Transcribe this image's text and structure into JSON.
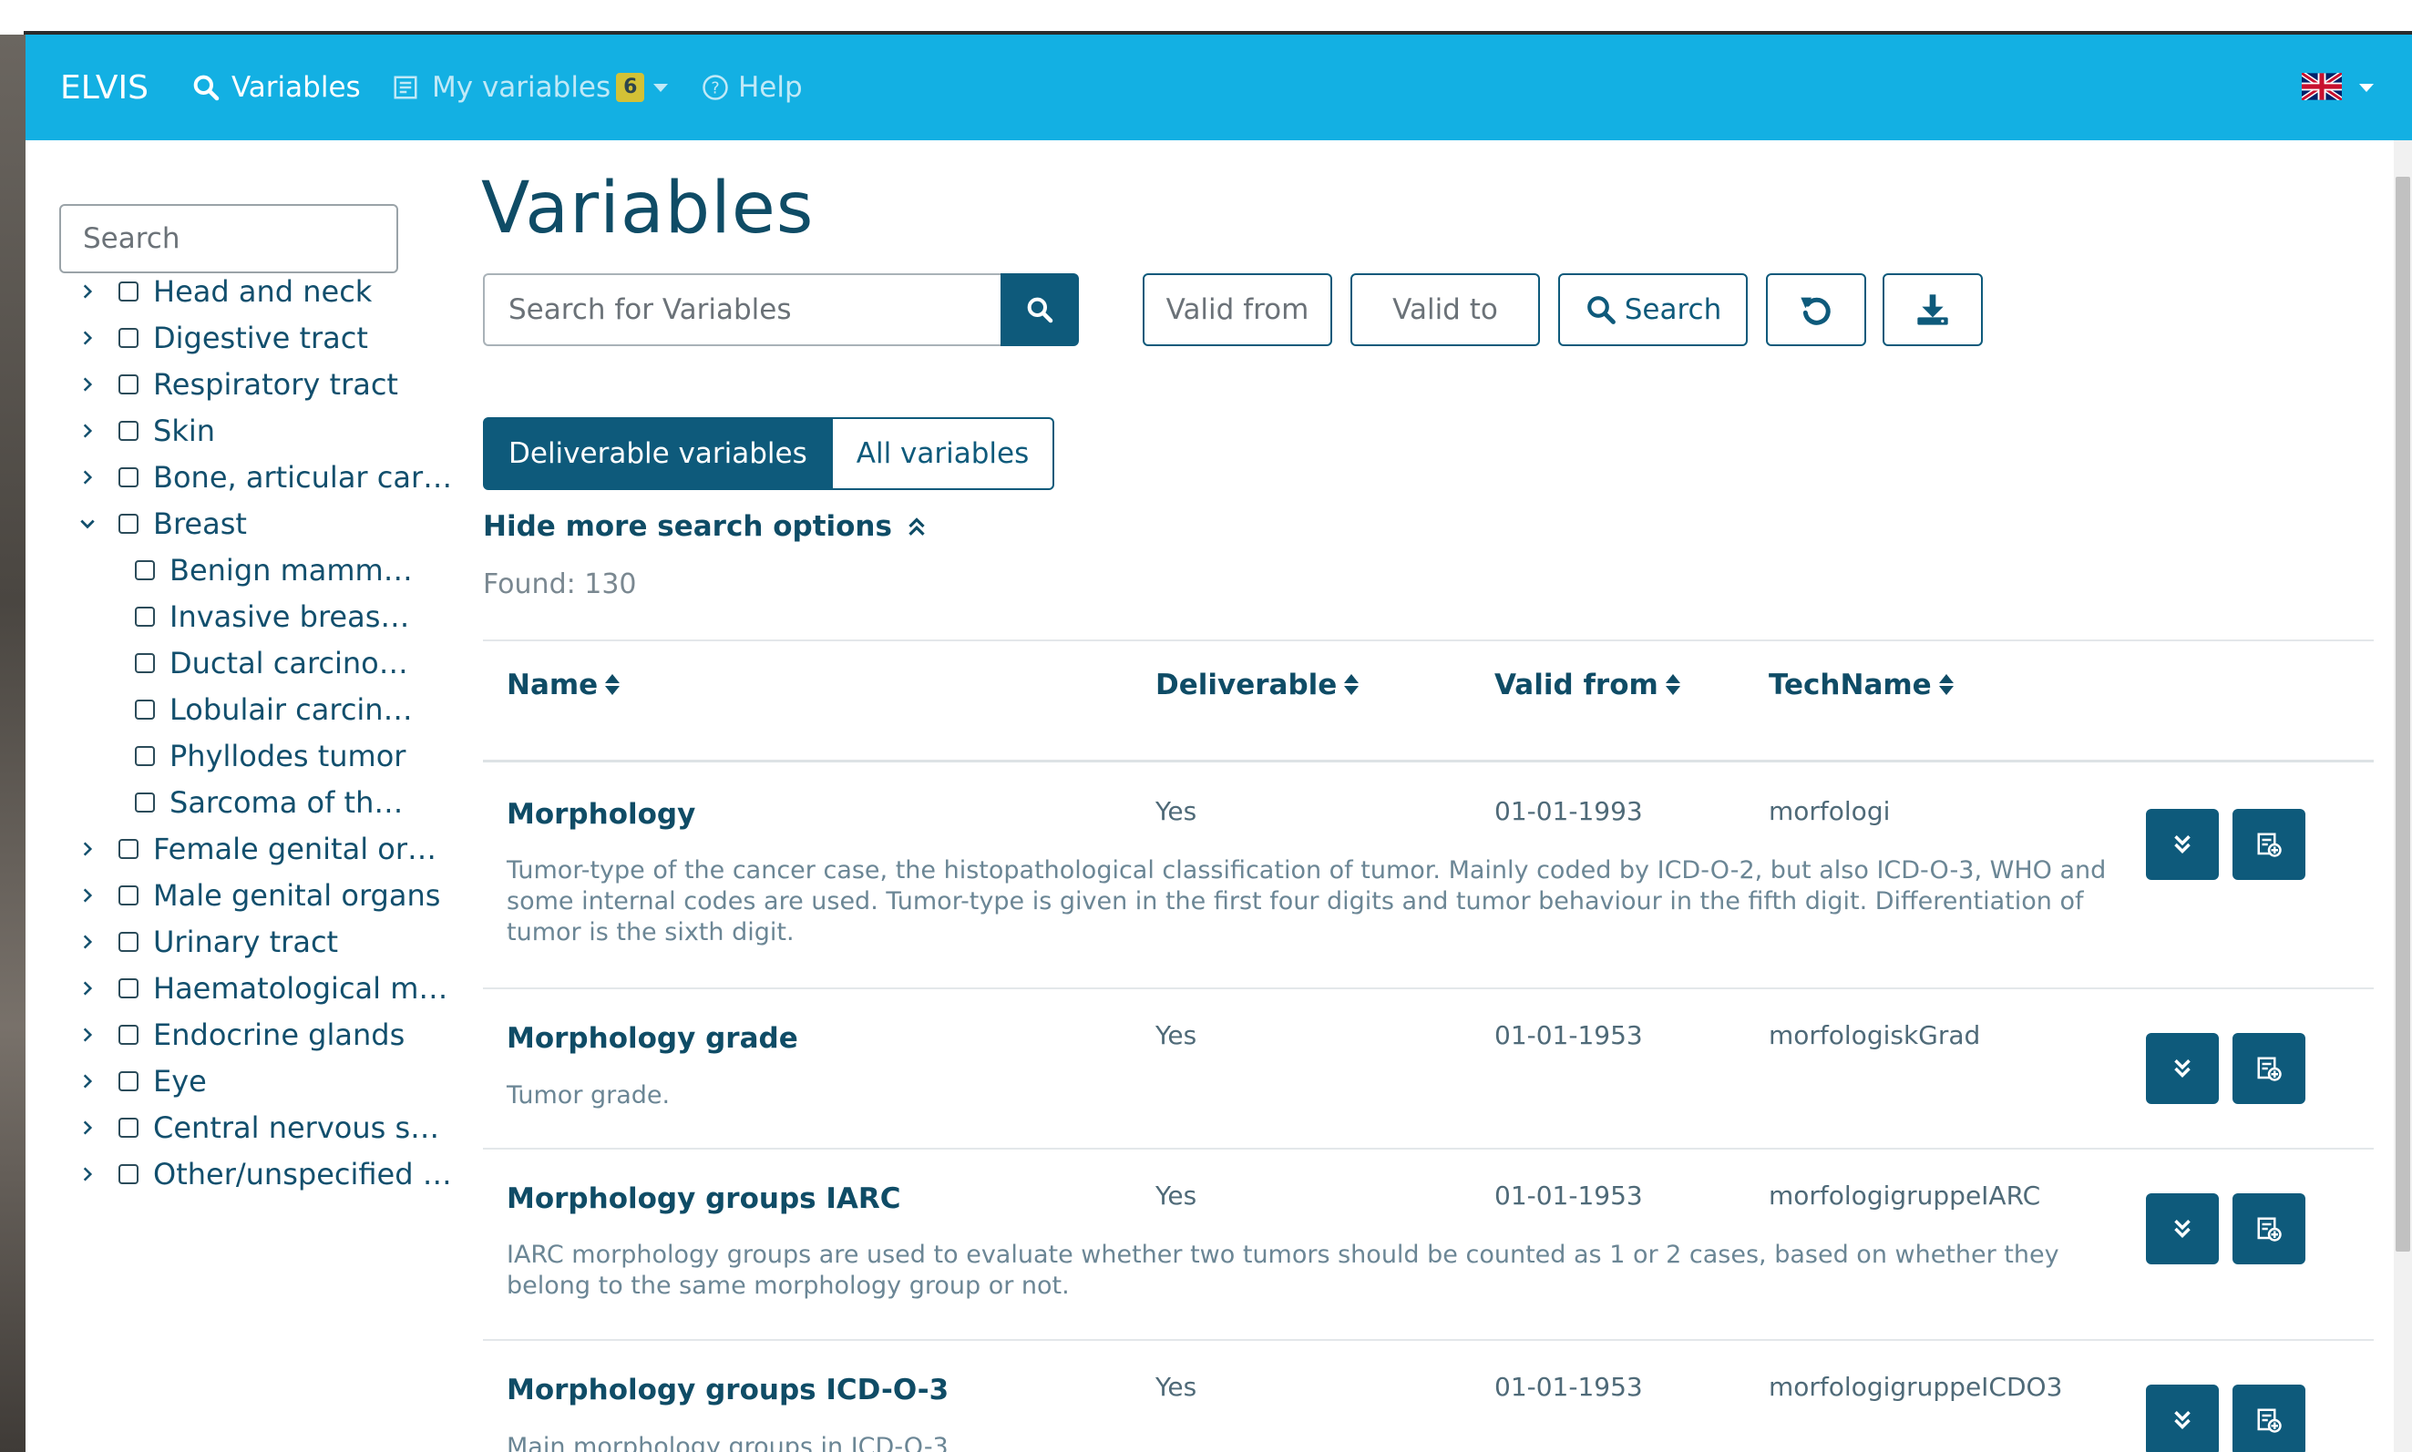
{
  "navbar": {
    "brand": "ELVIS",
    "variables_label": "Variables",
    "my_variables_label": "My variables",
    "my_variables_count": "6",
    "help_label": "Help",
    "language_icon": "uk-flag-icon"
  },
  "sidebar": {
    "search_placeholder": "Search",
    "items": [
      {
        "label": "Head and neck",
        "expanded": false,
        "level": 0
      },
      {
        "label": "Digestive tract",
        "expanded": false,
        "level": 0
      },
      {
        "label": "Respiratory tract",
        "expanded": false,
        "level": 0
      },
      {
        "label": "Skin",
        "expanded": false,
        "level": 0
      },
      {
        "label": "Bone, articular car…",
        "expanded": false,
        "level": 0
      },
      {
        "label": "Breast",
        "expanded": true,
        "level": 0
      },
      {
        "label": "Benign mamm…",
        "level": 1
      },
      {
        "label": "Invasive breas…",
        "level": 1
      },
      {
        "label": "Ductal carcino…",
        "level": 1
      },
      {
        "label": "Lobulair carcin…",
        "level": 1
      },
      {
        "label": "Phyllodes tumor",
        "level": 1
      },
      {
        "label": "Sarcoma of th…",
        "level": 1
      },
      {
        "label": "Female genital or…",
        "expanded": false,
        "level": 0
      },
      {
        "label": "Male genital organs",
        "expanded": false,
        "level": 0
      },
      {
        "label": "Urinary tract",
        "expanded": false,
        "level": 0
      },
      {
        "label": "Haematological m…",
        "expanded": false,
        "level": 0
      },
      {
        "label": "Endocrine glands",
        "expanded": false,
        "level": 0
      },
      {
        "label": "Eye",
        "expanded": false,
        "level": 0
      },
      {
        "label": "Central nervous s…",
        "expanded": false,
        "level": 0
      },
      {
        "label": "Other/unspecified …",
        "expanded": false,
        "level": 0
      }
    ]
  },
  "main": {
    "title": "Variables",
    "search_placeholder": "Search for Variables",
    "valid_from_label": "Valid from",
    "valid_to_label": "Valid to",
    "search_button_label": "Search",
    "toggle_deliverable": "Deliverable variables",
    "toggle_all": "All variables",
    "hide_options_label": "Hide more search options",
    "found_text": "Found: 130",
    "columns": [
      "Name",
      "Deliverable",
      "Valid from",
      "TechName"
    ],
    "rows": [
      {
        "name": "Morphology",
        "deliverable": "Yes",
        "valid_from": "01-01-1993",
        "techname": "morfologi",
        "description": "Tumor-type of the cancer case, the histopathological classification of tumor. Mainly coded by ICD-O-2, but also ICD-O-3, WHO and some internal codes are used. Tumor-type is given in the first four digits and tumor behaviour in the fifth digit. Differentiation of tumor is the sixth digit."
      },
      {
        "name": "Morphology grade",
        "deliverable": "Yes",
        "valid_from": "01-01-1953",
        "techname": "morfologiskGrad",
        "description": "Tumor grade."
      },
      {
        "name": "Morphology groups IARC",
        "deliverable": "Yes",
        "valid_from": "01-01-1953",
        "techname": "morfologigruppeIARC",
        "description": "IARC morphology groups are used to evaluate whether two tumors should be counted as 1 or 2 cases, based on whether they belong to the same morphology group or not."
      },
      {
        "name": "Morphology groups ICD-O-3",
        "deliverable": "Yes",
        "valid_from": "01-01-1953",
        "techname": "morfologigruppeICDO3",
        "description": "Main morphology groups in ICD-O-3"
      }
    ]
  },
  "colors": {
    "navbar": "#13b0e3",
    "primary": "#0e5a7b",
    "badge": "#f5c518"
  }
}
